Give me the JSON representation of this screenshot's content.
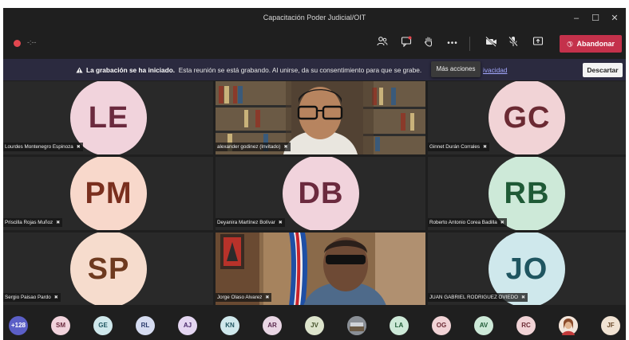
{
  "window": {
    "title": "Capacitación Poder Judicial/OIT",
    "minimize": "–",
    "maximize": "☐",
    "close": "✕"
  },
  "toolbar": {
    "timer": "-:--",
    "people_icon": "people-icon",
    "chat_icon": "chat-icon",
    "raise_hand_icon": "raise-hand-icon",
    "more_actions": "•••",
    "camera_icon": "camera-off-icon",
    "mic_icon": "mic-off-icon",
    "share_icon": "share-tray-icon",
    "leave_label": "Abandonar",
    "leave_color": "#c4314b"
  },
  "banner": {
    "title": "La grabación se ha iniciado.",
    "text": "Esta reunión se está grabando. Al unirse, da su consentimiento para que se grabe.",
    "privacy_link": "ivacidad",
    "dismiss_label": "Descartar"
  },
  "tooltip": {
    "text": "Más acciones"
  },
  "tiles": [
    {
      "initials": "LE",
      "name": "Lourdes Montenegro Espinoza",
      "bg": "#f1d3dc",
      "fg": "#6b2a3e"
    },
    {
      "initials": "",
      "name": "alexander godinez (Invitado)",
      "bg": "",
      "fg": ""
    },
    {
      "initials": "GC",
      "name": "Ginnet Durán Corrales",
      "bg": "#f1d3d6",
      "fg": "#6b2a33"
    },
    {
      "initials": "PM",
      "name": "Priscilla Rojas Muñoz",
      "bg": "#f8d8cb",
      "fg": "#7a2f1e"
    },
    {
      "initials": "DB",
      "name": "Deyanira Martínez Bolívar",
      "bg": "#f1d3dc",
      "fg": "#6b2a3e"
    },
    {
      "initials": "RB",
      "name": "Roberto Antonio Corea Badilla",
      "bg": "#cde9d8",
      "fg": "#1f5a36"
    },
    {
      "initials": "SP",
      "name": "Sergio Paisao Pardo",
      "bg": "#f6dccd",
      "fg": "#6e3a1f"
    },
    {
      "initials": "",
      "name": "Jorge Olaso Alvarez",
      "bg": "",
      "fg": ""
    },
    {
      "initials": "JO",
      "name": "JUAN GABRIEL RODRIGUEZ OVIEDO",
      "bg": "#cfe8ec",
      "fg": "#1f5560"
    }
  ],
  "strip": [
    {
      "label": "+128",
      "bg": "#5b5fc7",
      "fg": "#ffffff"
    },
    {
      "label": "SM",
      "bg": "#f1d3dc",
      "fg": "#6b2a3e"
    },
    {
      "label": "GE",
      "bg": "#cfe8ec",
      "fg": "#1f5560"
    },
    {
      "label": "RL",
      "bg": "#d6dcf1",
      "fg": "#2a3a6b"
    },
    {
      "label": "AJ",
      "bg": "#e4d6f1",
      "fg": "#4a2a6b"
    },
    {
      "label": "KN",
      "bg": "#cfe8ec",
      "fg": "#1f5560"
    },
    {
      "label": "AR",
      "bg": "#e9d6e4",
      "fg": "#5a2a4e"
    },
    {
      "label": "JV",
      "bg": "#dde4cc",
      "fg": "#44522a"
    },
    {
      "label": "",
      "bg": "#8a8f96",
      "fg": "#ffffff"
    },
    {
      "label": "LA",
      "bg": "#cde9d8",
      "fg": "#1f5a36"
    },
    {
      "label": "OG",
      "bg": "#f1d3d6",
      "fg": "#6b2a33"
    },
    {
      "label": "AV",
      "bg": "#cde9d8",
      "fg": "#1f5a36"
    },
    {
      "label": "RC",
      "bg": "#f1d3d6",
      "fg": "#6b2a33"
    },
    {
      "label": "",
      "bg": "#c98a6b",
      "fg": "#ffffff"
    },
    {
      "label": "JF",
      "bg": "#f1e3d3",
      "fg": "#6b4a2a"
    }
  ]
}
